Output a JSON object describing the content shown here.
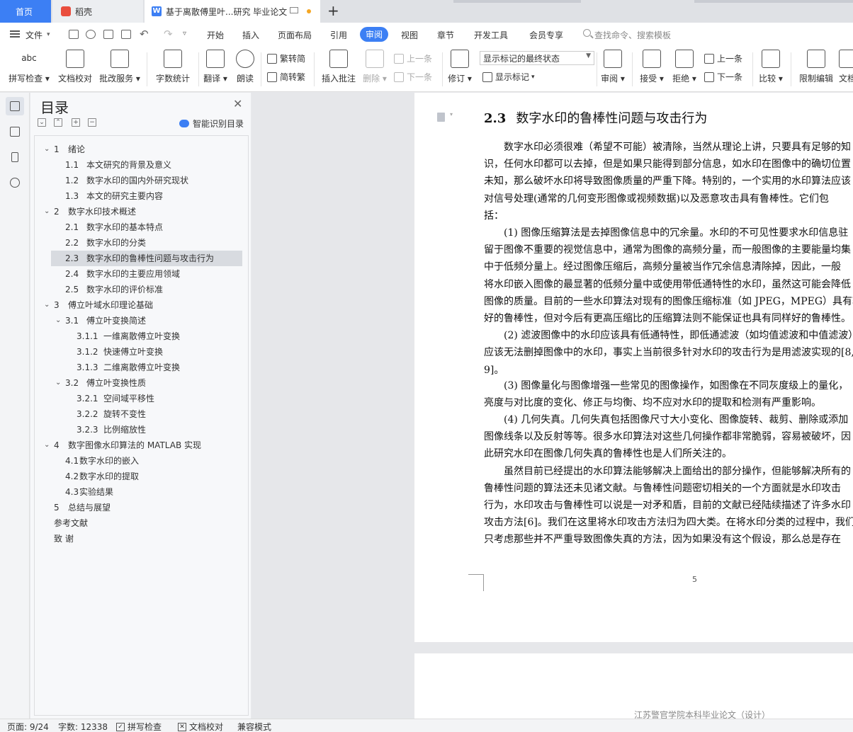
{
  "tabs": {
    "home": "首页",
    "daoke": "稻壳",
    "doc_icon": "W",
    "doc": "基于离散傅里叶...研究 毕业论文"
  },
  "menu": {
    "file": "文件",
    "items": [
      "开始",
      "插入",
      "页面布局",
      "引用",
      "审阅",
      "视图",
      "章节",
      "开发工具",
      "会员专享"
    ],
    "active": "审阅",
    "search": "查找命令、搜索模板"
  },
  "ribbon": {
    "spell": "拼写检查",
    "doc_check": "文档校对",
    "batch_service": "批改服务",
    "word_count": "字数统计",
    "translate": "翻译",
    "read_aloud": "朗读",
    "trad_simp": "繁转简",
    "simp_trad": "简转繁",
    "insert_comment": "插入批注",
    "delete": "删除",
    "prev": "上一条",
    "next": "下一条",
    "revise": "修订",
    "markup_state": "显示标记的最终状态",
    "show_markup": "显示标记",
    "review": "审阅",
    "accept": "接受",
    "reject": "拒绝",
    "prev2": "上一条",
    "next2": "下一条",
    "compare": "比较",
    "restrict": "限制编辑",
    "doc_cut": "文档"
  },
  "toc": {
    "title": "目录",
    "smart": "智能识别目录",
    "items": [
      {
        "num": "1",
        "text": "绪论",
        "level": 1,
        "caret": true
      },
      {
        "num": "1.1",
        "text": "本文研究的背景及意义",
        "level": 2
      },
      {
        "num": "1.2",
        "text": "数字水印的国内外研究现状",
        "level": 2
      },
      {
        "num": "1.3",
        "text": "本文的研究主要内容",
        "level": 2
      },
      {
        "num": "2",
        "text": "数字水印技术概述",
        "level": 1,
        "caret": true
      },
      {
        "num": "2.1",
        "text": "数字水印的基本特点",
        "level": 2
      },
      {
        "num": "2.2",
        "text": "数字水印的分类",
        "level": 2
      },
      {
        "num": "2.3",
        "text": "数字水印的鲁棒性问题与攻击行为",
        "level": 2,
        "selected": true
      },
      {
        "num": "2.4",
        "text": "数字水印的主要应用领域",
        "level": 2
      },
      {
        "num": "2.5",
        "text": "数字水印的评价标准",
        "level": 2
      },
      {
        "num": "3",
        "text": "傅立叶域水印理论基础",
        "level": 1,
        "caret": true
      },
      {
        "num": "3.1",
        "text": "傅立叶变换简述",
        "level": 2,
        "caret": true
      },
      {
        "num": "3.1.1",
        "text": "一维离散傅立叶变换",
        "level": 3
      },
      {
        "num": "3.1.2",
        "text": "快速傅立叶变换",
        "level": 3
      },
      {
        "num": "3.1.3",
        "text": "二维离散傅立叶变换",
        "level": 3
      },
      {
        "num": "3.2",
        "text": "傅立叶变换性质",
        "level": 2,
        "caret": true
      },
      {
        "num": "3.2.1",
        "text": "空间域平移性",
        "level": 3
      },
      {
        "num": "3.2.2",
        "text": "旋转不变性",
        "level": 3
      },
      {
        "num": "3.2.3",
        "text": "比例缩放性",
        "level": 3
      },
      {
        "num": "4",
        "text": "数字图像水印算法的 MATLAB  实现",
        "level": 1,
        "caret": true
      },
      {
        "num": "4.1",
        "text": "数字水印的嵌入",
        "level": 2,
        "tight": true
      },
      {
        "num": "4.2",
        "text": "数字水印的提取",
        "level": 2,
        "tight": true
      },
      {
        "num": "4.3",
        "text": "实验结果",
        "level": 2,
        "tight": true
      },
      {
        "num": "5",
        "text": "总结与展望",
        "level": 1
      },
      {
        "num": "",
        "text": "参考文献",
        "level": 0
      },
      {
        "num": "",
        "text": "致    谢",
        "level": 0
      }
    ]
  },
  "document": {
    "heading_num": "2.3",
    "heading_text": "数字水印的鲁棒性问题与攻击行为",
    "lines": [
      "　　数字水印必须很难（希望不可能）被清除，当然从理论上讲，只要具有足够的知",
      "识，任何水印都可以去掉，但是如果只能得到部分信息，如水印在图像中的确切位置",
      "未知，那么破坏水印将导致图像质量的严重下降。特别的，一个实用的水印算法应该",
      "对信号处理(通常的几何变形图像或视频数据)以及恶意攻击具有鲁棒性。它们包",
      "括：",
      "　　(1) 图像压缩算法是去掉图像信息中的冗余量。水印的不可见性要求水印信息驻",
      "留于图像不重要的视觉信息中，通常为图像的高频分量，而一般图像的主要能量均集",
      "中于低频分量上。经过图像压缩后，高频分量被当作冗余信息清除掉，因此，一般",
      "将水印嵌入图像的最显著的低频分量中或使用带低通特性的水印，虽然这可能会降低",
      "图像的质量。目前的一些水印算法对现有的图像压缩标准（如 JPEG，MPEG）具有较",
      "好的鲁棒性，但对今后有更高压缩比的压缩算法则不能保证也具有同样好的鲁棒性。",
      "　　(2) 滤波图像中的水印应该具有低通特性，即低通滤波（如均值滤波和中值滤波）",
      "应该无法删掉图像中的水印，事实上当前很多针对水印的攻击行为是用滤波实现的[8,",
      "9]。",
      "　　(3) 图像量化与图像增强一些常见的图像操作，如图像在不同灰度级上的量化，",
      "亮度与对比度的变化、修正与均衡、均不应对水印的提取和检测有严重影响。",
      "　　(4) 几何失真。几何失真包括图像尺寸大小变化、图像旋转、裁剪、删除或添加",
      "图像线条以及反射等等。很多水印算法对这些几何操作都非常脆弱，容易被破坏，因",
      "此研究水印在图像几何失真的鲁棒性也是人们所关注的。",
      "　　虽然目前已经提出的水印算法能够解决上面给出的部分操作，但能够解决所有的",
      "鲁棒性问题的算法还未见诸文献。与鲁棒性问题密切相关的一个方面就是水印攻击",
      "行为，水印攻击与鲁棒性可以说是一对矛和盾，目前的文献已经陆续描述了许多水印",
      "攻击方法[6]。我们在这里将水印攻击方法归为四大类。在将水印分类的过程中，我们",
      "只考虑那些并不严重导致图像失真的方法，因为如果没有这个假设，那么总是存在"
    ],
    "page_number": "5",
    "next_page_header": "江苏警官学院本科毕业论文（设计）"
  },
  "status": {
    "page": "页面: 9/24",
    "words": "字数: 12338",
    "spell": "拼写检查",
    "doc_check": "文档校对",
    "compat": "兼容模式"
  }
}
